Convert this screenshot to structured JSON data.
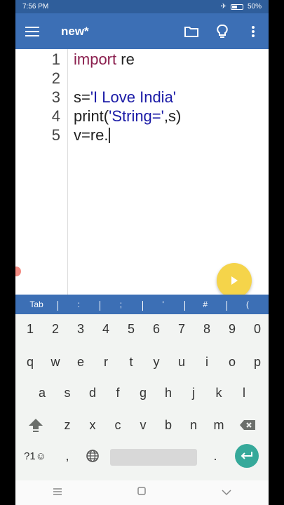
{
  "status": {
    "time": "7:56 PM",
    "battery": "50%"
  },
  "app": {
    "title": "new*"
  },
  "editor": {
    "line_numbers": [
      "1",
      "2",
      "3",
      "4",
      "5"
    ],
    "line1": {
      "kw": "import",
      "rest": " re"
    },
    "line3": {
      "a": "s=",
      "b": "'I Love India'"
    },
    "line4": {
      "a": "print(",
      "b": "'String='",
      "c": ",s)"
    },
    "line5": {
      "a": "v=re."
    }
  },
  "symbol_bar": [
    "Tab",
    ":",
    ";",
    "'",
    "#",
    "("
  ],
  "keyboard": {
    "row1": [
      "1",
      "2",
      "3",
      "4",
      "5",
      "6",
      "7",
      "8",
      "9",
      "0"
    ],
    "row2": [
      "q",
      "w",
      "e",
      "r",
      "t",
      "y",
      "u",
      "i",
      "o",
      "p"
    ],
    "row3": [
      "a",
      "s",
      "d",
      "f",
      "g",
      "h",
      "j",
      "k",
      "l"
    ],
    "row4": [
      "z",
      "x",
      "c",
      "v",
      "b",
      "n",
      "m"
    ],
    "symbols_key": "?1☺",
    "comma_key": ",",
    "period_key": "."
  },
  "colors": {
    "appbar": "#3c6fb5",
    "statusbar": "#2f5e9b",
    "fab": "#f5d44a",
    "enter": "#36a99a",
    "keyword": "#8a1e4d",
    "string": "#1a1aa6"
  },
  "icons": [
    "menu-icon",
    "folder-icon",
    "lightbulb-icon",
    "more-vert-icon",
    "play-icon",
    "shift-icon",
    "backspace-icon",
    "globe-icon",
    "enter-icon",
    "nav-recents-icon",
    "nav-home-icon",
    "nav-back-icon"
  ]
}
